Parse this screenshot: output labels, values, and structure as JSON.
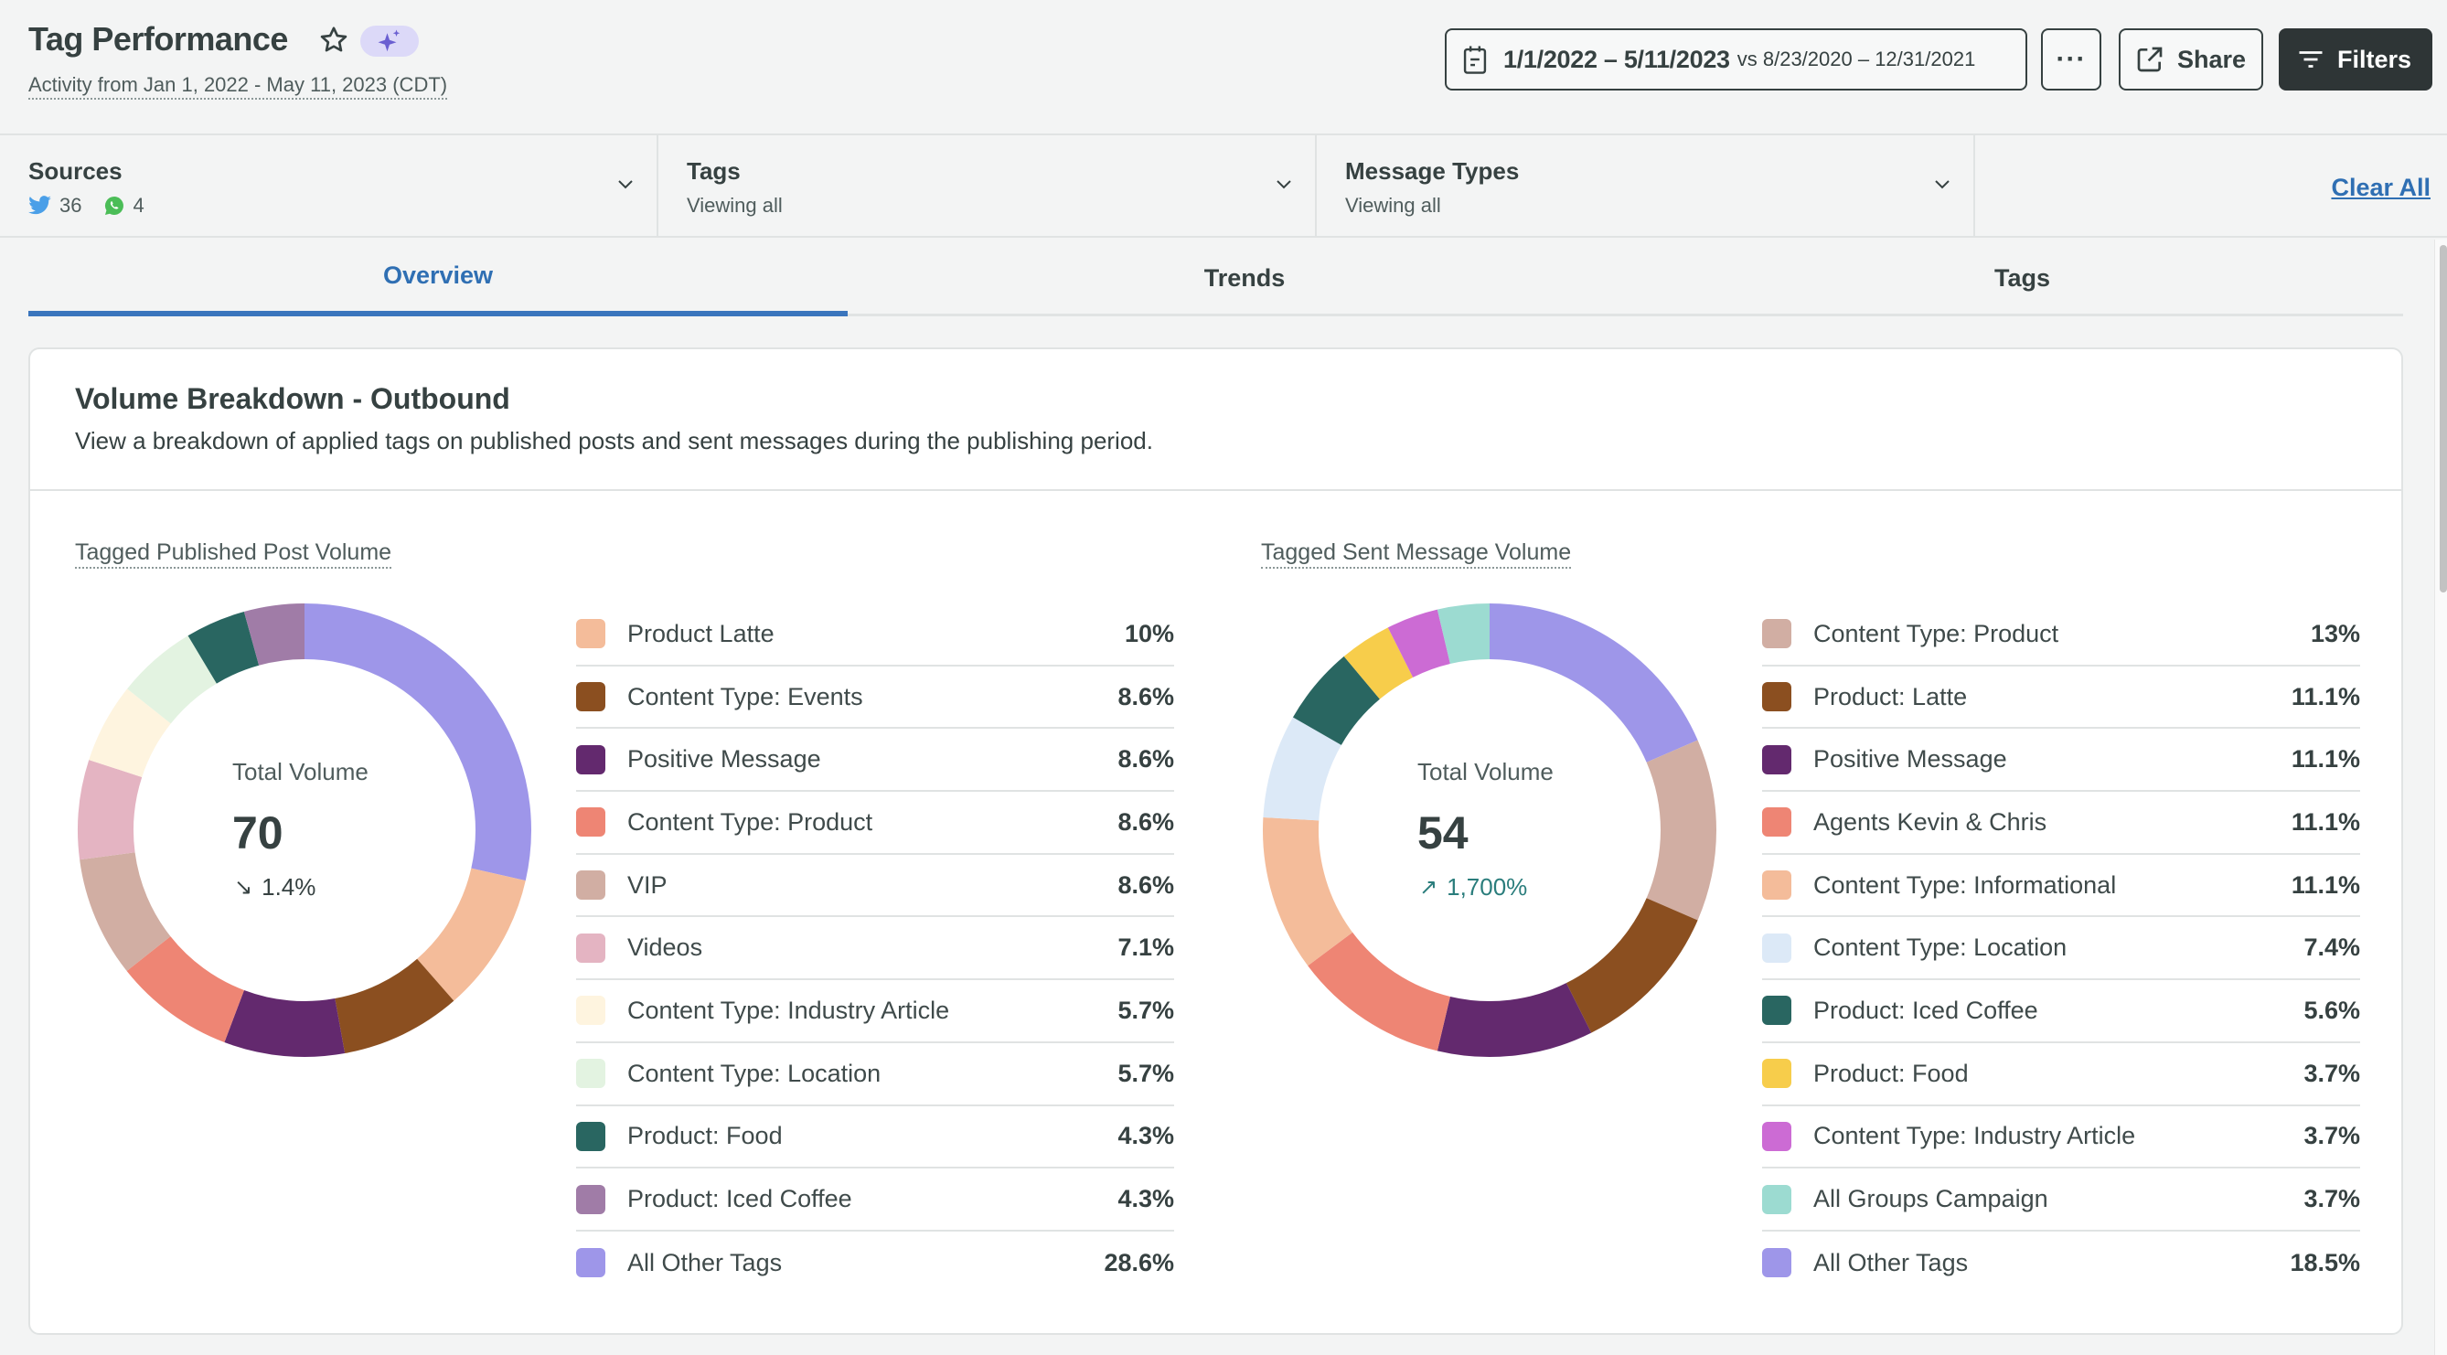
{
  "header": {
    "title": "Tag Performance",
    "subtitle": "Activity from Jan 1, 2022 - May 11, 2023 (CDT)",
    "date_range": "1/1/2022 – 5/11/2023",
    "compare_range": "vs 8/23/2020 – 12/31/2021",
    "more_label": "···",
    "share_label": "Share",
    "filters_label": "Filters",
    "ai_badge_color": "#dcd9f8",
    "ai_icon_color": "#6a5fd1"
  },
  "filter_bar": {
    "sources": {
      "title": "Sources",
      "items": [
        {
          "icon": "twitter-icon",
          "count": "36",
          "color": "#4a9fe8"
        },
        {
          "icon": "whatsapp-icon",
          "count": "4",
          "color": "#4bbd57"
        }
      ]
    },
    "tags": {
      "title": "Tags",
      "sub": "Viewing all"
    },
    "message_types": {
      "title": "Message Types",
      "sub": "Viewing all"
    },
    "clear_all": "Clear All"
  },
  "tabs": [
    {
      "label": "Overview",
      "active": true
    },
    {
      "label": "Trends",
      "active": false
    },
    {
      "label": "Tags",
      "active": false
    }
  ],
  "card": {
    "title": "Volume Breakdown - Outbound",
    "description": "View a breakdown of applied tags on published posts and sent messages during the publishing period."
  },
  "chart_data": [
    {
      "type": "pie",
      "title": "Tagged Published Post Volume",
      "center_label": "Total Volume",
      "total": "70",
      "delta": "1.4%",
      "delta_direction": "down",
      "start": "top, clockwise, starting with All Other Tags",
      "legend": [
        {
          "label": "Product Latte",
          "value": 10,
          "display": "10%",
          "color": "#f4bc9a"
        },
        {
          "label": "Content Type: Events",
          "value": 8.6,
          "display": "8.6%",
          "color": "#8b4f20"
        },
        {
          "label": "Positive Message",
          "value": 8.6,
          "display": "8.6%",
          "color": "#63296e"
        },
        {
          "label": "Content Type: Product",
          "value": 8.6,
          "display": "8.6%",
          "color": "#ee8574"
        },
        {
          "label": "VIP",
          "value": 8.6,
          "display": "8.6%",
          "color": "#d1aea3"
        },
        {
          "label": "Videos",
          "value": 7.1,
          "display": "7.1%",
          "color": "#e4b4c2"
        },
        {
          "label": "Content Type: Industry Article",
          "value": 5.7,
          "display": "5.7%",
          "color": "#fef4df"
        },
        {
          "label": "Content Type: Location",
          "value": 5.7,
          "display": "5.7%",
          "color": "#e3f3e1"
        },
        {
          "label": "Product: Food",
          "value": 4.3,
          "display": "4.3%",
          "color": "#296661"
        },
        {
          "label": "Product: Iced Coffee",
          "value": 4.3,
          "display": "4.3%",
          "color": "#a07ca7"
        },
        {
          "label": "All Other Tags",
          "value": 28.6,
          "display": "28.6%",
          "color": "#9e96e9"
        }
      ]
    },
    {
      "type": "pie",
      "title": "Tagged Sent Message Volume",
      "center_label": "Total Volume",
      "total": "54",
      "delta": "1,700%",
      "delta_direction": "up",
      "start": "top, clockwise, starting with All Other Tags",
      "legend": [
        {
          "label": "Content Type: Product",
          "value": 13,
          "display": "13%",
          "color": "#d1aea3"
        },
        {
          "label": "Product: Latte",
          "value": 11.1,
          "display": "11.1%",
          "color": "#8b4f20"
        },
        {
          "label": "Positive Message",
          "value": 11.1,
          "display": "11.1%",
          "color": "#63296e"
        },
        {
          "label": "Agents Kevin & Chris",
          "value": 11.1,
          "display": "11.1%",
          "color": "#ee8574"
        },
        {
          "label": "Content Type: Informational",
          "value": 11.1,
          "display": "11.1%",
          "color": "#f4bc9a"
        },
        {
          "label": "Content Type: Location",
          "value": 7.4,
          "display": "7.4%",
          "color": "#dce9f7"
        },
        {
          "label": "Product: Iced Coffee",
          "value": 5.6,
          "display": "5.6%",
          "color": "#296661"
        },
        {
          "label": "Product: Food",
          "value": 3.7,
          "display": "3.7%",
          "color": "#f7cd4b"
        },
        {
          "label": "Content Type: Industry Article",
          "value": 3.7,
          "display": "3.7%",
          "color": "#cc6bd4"
        },
        {
          "label": "All Groups Campaign",
          "value": 3.7,
          "display": "3.7%",
          "color": "#9cdbd1"
        },
        {
          "label": "All Other Tags",
          "value": 18.5,
          "display": "18.5%",
          "color": "#9e96e9"
        }
      ]
    }
  ],
  "colors": {
    "accent": "#2f6fb3",
    "text": "#364141",
    "muted": "#4f5c5c",
    "positive": "#2a7d7c"
  }
}
